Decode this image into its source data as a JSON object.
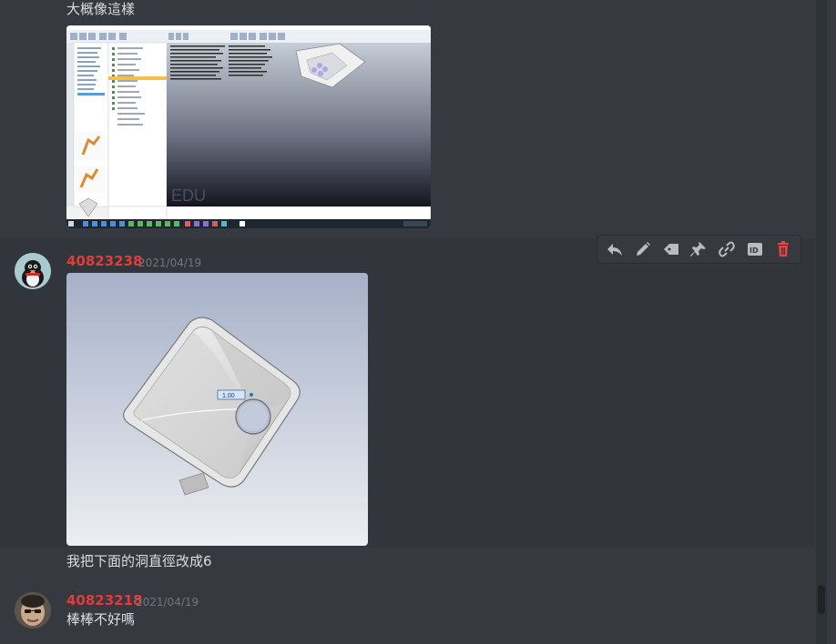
{
  "messages": [
    {
      "text": "大概像這樣"
    },
    {
      "username": "40823238",
      "timestamp": "2021/04/19",
      "caption": "我把下面的洞直徑改成6",
      "inner_label": "1.00"
    },
    {
      "username": "40823218",
      "timestamp": "2021/04/19",
      "text": "棒棒不好嗎"
    }
  ],
  "screenshot_overlay_text": "EDU",
  "toolbar": {
    "buttons": [
      "reply-icon",
      "edit-icon",
      "tag-icon",
      "pin-icon",
      "link-icon",
      "id-icon",
      "delete-icon"
    ],
    "id_label": "ID"
  },
  "colors": {
    "background": "#36393f",
    "username": "#e03c3c",
    "delete": "#ed4245"
  }
}
